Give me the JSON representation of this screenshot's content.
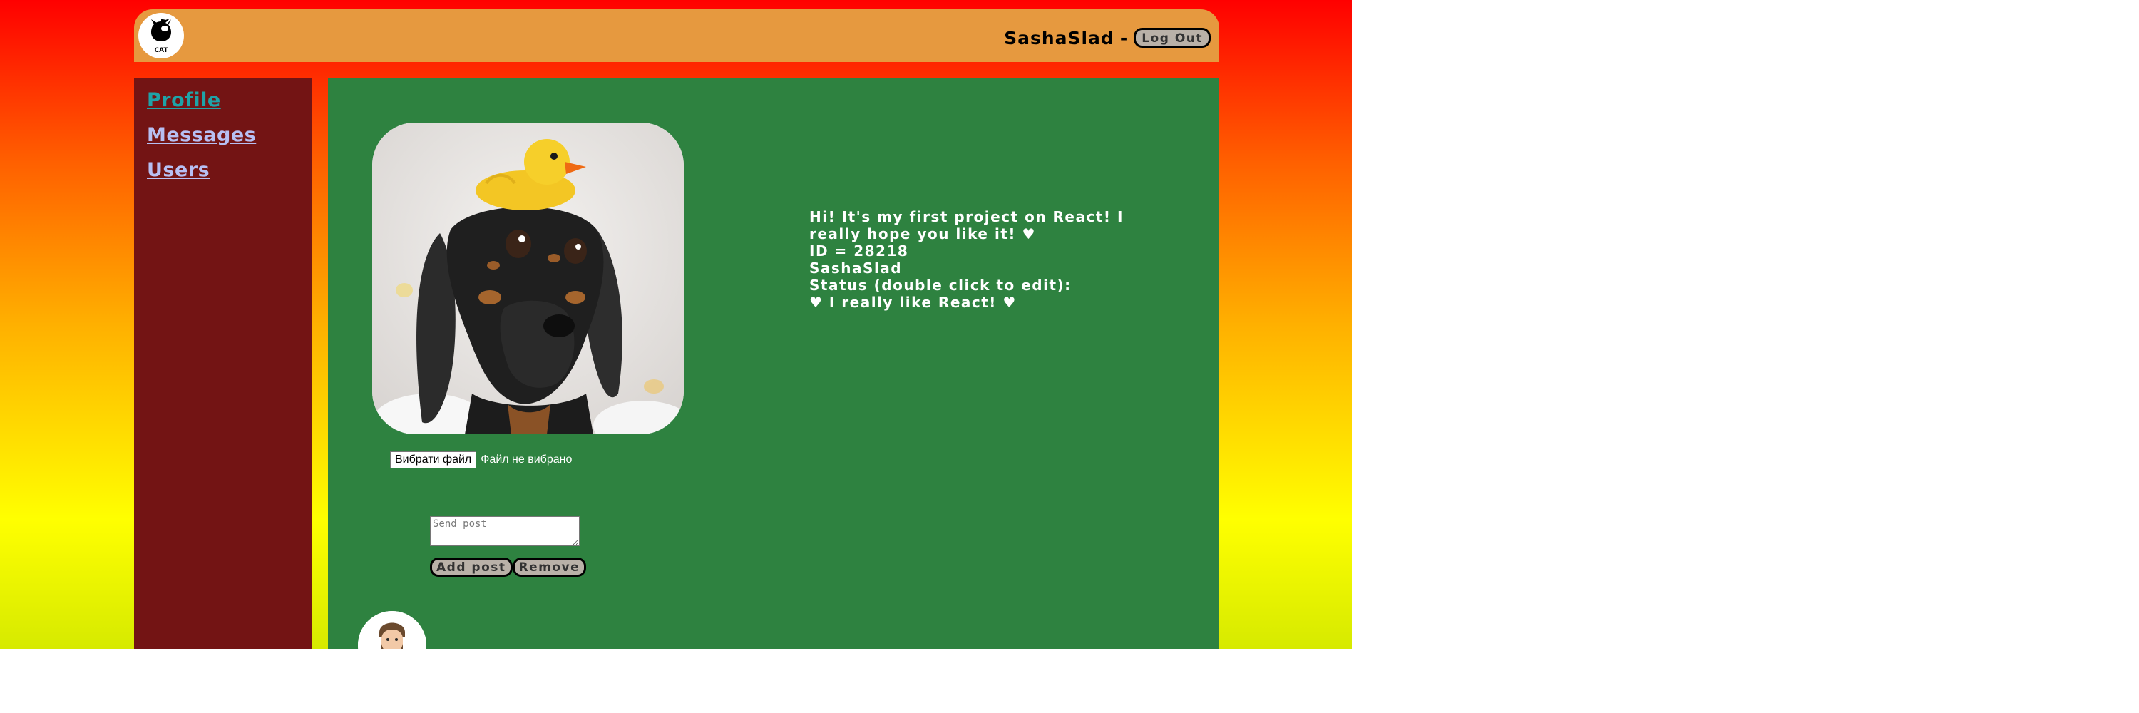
{
  "header": {
    "logo_text": "CAT",
    "username": "SashaSlad",
    "separator": "-",
    "logout_label": "Log Out"
  },
  "sidebar": {
    "items": [
      {
        "label": "Profile",
        "active": true
      },
      {
        "label": "Messages",
        "active": false
      },
      {
        "label": "Users",
        "active": false
      }
    ]
  },
  "profile": {
    "about": "Hi! It's my first project on React! I really hope you like it! ♥",
    "id_line": "ID = 28218",
    "name": "SashaSlad",
    "status_label": "Status (double click to edit):",
    "status_value": "♥ I really like React! ♥"
  },
  "file_upload": {
    "button_label": "Вибрати файл",
    "status_text": "Файл не вибрано"
  },
  "post_form": {
    "placeholder": "Send post",
    "add_label": "Add post",
    "remove_label": "Remove"
  },
  "colors": {
    "header": "#e6993f",
    "sidebar": "#731414",
    "main": "#2e8240",
    "nav_link": "#b7bff3",
    "nav_link_active": "#1fa3a8"
  },
  "icons": {
    "logo": "cat-logo-icon",
    "profile_photo": "dachshund-with-rubber-duck-photo",
    "avatar": "man-avatar-icon"
  }
}
